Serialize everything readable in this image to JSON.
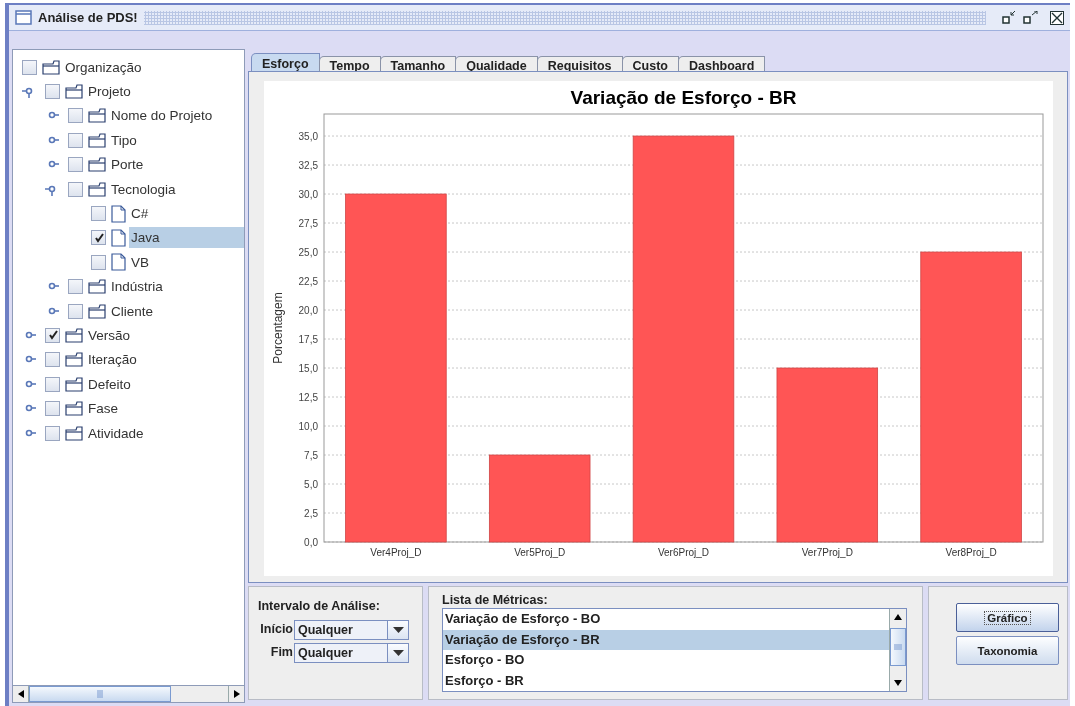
{
  "window": {
    "title": "Análise de PDS!"
  },
  "tree": [
    {
      "label": "Organização",
      "kind": "folder",
      "checked": false,
      "selected": false,
      "children": [
        {
          "label": "Projeto",
          "kind": "folder",
          "checked": false,
          "selected": false,
          "expanded": true,
          "children": [
            {
              "label": "Nome do Projeto",
              "kind": "folder",
              "checked": false,
              "selected": false,
              "expanded": false
            },
            {
              "label": "Tipo",
              "kind": "folder",
              "checked": false,
              "selected": false,
              "expanded": false
            },
            {
              "label": "Porte",
              "kind": "folder",
              "checked": false,
              "selected": false,
              "expanded": false
            },
            {
              "label": "Tecnologia",
              "kind": "folder",
              "checked": false,
              "selected": false,
              "expanded": true,
              "children": [
                {
                  "label": "C#",
                  "kind": "leaf",
                  "checked": false,
                  "selected": false
                },
                {
                  "label": "Java",
                  "kind": "leaf",
                  "checked": true,
                  "selected": true
                },
                {
                  "label": "VB",
                  "kind": "leaf",
                  "checked": false,
                  "selected": false
                }
              ]
            },
            {
              "label": "Indústria",
              "kind": "folder",
              "checked": false,
              "selected": false,
              "expanded": false
            },
            {
              "label": "Cliente",
              "kind": "folder",
              "checked": false,
              "selected": false,
              "expanded": false
            }
          ]
        },
        {
          "label": "Versão",
          "kind": "folder",
          "checked": true,
          "selected": false,
          "expanded": false
        },
        {
          "label": "Iteração",
          "kind": "folder",
          "checked": false,
          "selected": false,
          "expanded": false
        },
        {
          "label": "Defeito",
          "kind": "folder",
          "checked": false,
          "selected": false,
          "expanded": false
        },
        {
          "label": "Fase",
          "kind": "folder",
          "checked": false,
          "selected": false,
          "expanded": false
        },
        {
          "label": "Atividade",
          "kind": "folder",
          "checked": false,
          "selected": false,
          "expanded": false
        }
      ]
    }
  ],
  "tabs": [
    {
      "label": "Esforço",
      "selected": true
    },
    {
      "label": "Tempo",
      "selected": false
    },
    {
      "label": "Tamanho",
      "selected": false
    },
    {
      "label": "Qualidade",
      "selected": false
    },
    {
      "label": "Requisitos",
      "selected": false
    },
    {
      "label": "Custo",
      "selected": false
    },
    {
      "label": "Dashboard",
      "selected": false
    }
  ],
  "chart": {
    "chart_data": {
      "type": "bar",
      "title": "Variação de Esforço - BR",
      "ylabel": "Porcentagem",
      "categories": [
        "Ver4Proj_D",
        "Ver5Proj_D",
        "Ver6Proj_D",
        "Ver7Proj_D",
        "Ver8Proj_D"
      ],
      "values": [
        30,
        7.5,
        35,
        15,
        25
      ],
      "ylim": [
        0,
        36.9
      ],
      "grid": true,
      "yticks": [
        {
          "value": 0,
          "label": "0,0"
        },
        {
          "value": 2.5,
          "label": "2,5"
        },
        {
          "value": 5,
          "label": "5,0"
        },
        {
          "value": 7.5,
          "label": "7,5"
        },
        {
          "value": 10,
          "label": "10,0"
        },
        {
          "value": 12.5,
          "label": "12,5"
        },
        {
          "value": 15,
          "label": "15,0"
        },
        {
          "value": 17.5,
          "label": "17,5"
        },
        {
          "value": 20,
          "label": "20,0"
        },
        {
          "value": 22.5,
          "label": "22,5"
        },
        {
          "value": 25,
          "label": "25,0"
        },
        {
          "value": 27.5,
          "label": "27,5"
        },
        {
          "value": 30,
          "label": "30,0"
        },
        {
          "value": 32.5,
          "label": "32,5"
        },
        {
          "value": 35,
          "label": "35,0"
        }
      ]
    }
  },
  "analysis_interval": {
    "title": "Intervalo de Análise:",
    "fields": [
      {
        "label": "Início",
        "value": "Qualquer"
      },
      {
        "label": "Fim",
        "value": "Qualquer"
      }
    ]
  },
  "metrics_list": {
    "title": "Lista de Métricas:",
    "items": [
      {
        "label": "Variação de Esforço - BO",
        "selected": false
      },
      {
        "label": "Variação de Esforço - BR",
        "selected": true
      },
      {
        "label": "Esforço - BO",
        "selected": false
      },
      {
        "label": "Esforço - BR",
        "selected": false
      }
    ]
  },
  "buttons": [
    {
      "label": "Gráfico",
      "focused": true
    },
    {
      "label": "Taxonomia",
      "focused": false
    }
  ]
}
